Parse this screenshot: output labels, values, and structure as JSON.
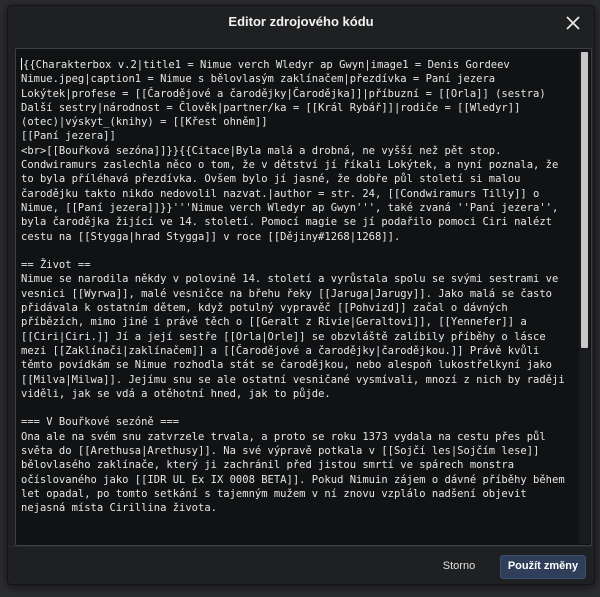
{
  "dialog": {
    "title": "Editor zdrojového kódu",
    "close_icon": "close-icon"
  },
  "editor": {
    "content": "{{Charakterbox v.2|title1 = Nimue verch Wledyr ap Gwyn|image1 = Denis Gordeev Nimue.jpeg|caption1 = Nimue s bělovlasým zaklínačem|přezdívka = Paní jezera Lokýtek|profese = [[Čarodějové a čarodějky|Čarodějka]]|příbuzní = [[Orla]] (sestra) Další sestry|národnost = Člověk|partner/ka = [[Král Rybář]]|rodiče = [[Wledyr]] (otec)|výskyt_(knihy) = [[Křest ohněm]]\n[[Paní jezera]]\n<br>[[Bouřková sezóna]]}}{{Citace|Byla malá a drobná, ne vyšší než pět stop. Condwiramurs zaslechla něco o tom, že v dětství jí říkali Lokýtek, a nyní poznala, že to byla příléhavá přezdívka. Ovšem bylo jí jasné, že dobře půl století si malou čarodějku takto nikdo nedovolil nazvat.|author = str. 24, [[Condwiramurs Tilly]] o Nimue, [[Paní jezera]]}}'''Nimue verch Wledyr ap Gwyn''', také zvaná ''Paní jezera'', byla čarodějka žijící ve 14. století. Pomocí magie se jí podařilo pomoci Ciri nalézt cestu na [[Stygga|hrad Stygga]] v roce [[Dějiny#1268|1268]].\n\n== Život ==\nNimue se narodila někdy v polovině 14. století a vyrůstala spolu se svými sestrami ve vesnici [[Wyrwa]], malé vesničce na břehu řeky [[Jaruga|Jarugy]]. Jako malá se často přidávala k ostatním dětem, když potulný vypravěč [[Pohvizd]] začal o dávných příbězích, mimo jiné i právě těch o [[Geralt z Rivie|Geraltovi]], [[Yennefer]] a [[Ciri|Ciri.]] Jí a její sestře [[Orla|Orle]] se obzvláště zalíbily příběhy o lásce mezi [[Zaklínači|zaklínačem]] a [[Čarodějové a čarodějky|čarodějkou.]] Právě kvůli těmto povídkám se Nimue rozhodla stát se čarodějkou, nebo alespoň lukostřelkyní jako [[Milva|Milwa]]. Jejímu snu se ale ostatní vesničané vysmívali, mnozí z nich by raději viděli, jak se vdá a otěhotní hned, jak to půjde.\n\n=== V Bouřkové sezóně ===\nOna ale na svém snu zatvrzele trvala, a proto se roku 1373 vydala na cestu přes půl světa do [[Arethusa|Arethusy]]. Na své výpravě potkala v [[Sojčí les|Sojčím lese]] bělovlasého zaklínače, který ji zachránil před jistou smrtí ve spárech monstra očíslovaného jako [[IDR UL Ex IX 0008 BETA]]. Pokud Nimuin zájem o dávné příběhy během let opadal, po tomto setkání s tajemným mužem v ní znovu vzplálo nadšení objevit nejasná místa Cirillina života."
  },
  "footer": {
    "cancel_label": "Storno",
    "apply_label": "Použít změny"
  }
}
